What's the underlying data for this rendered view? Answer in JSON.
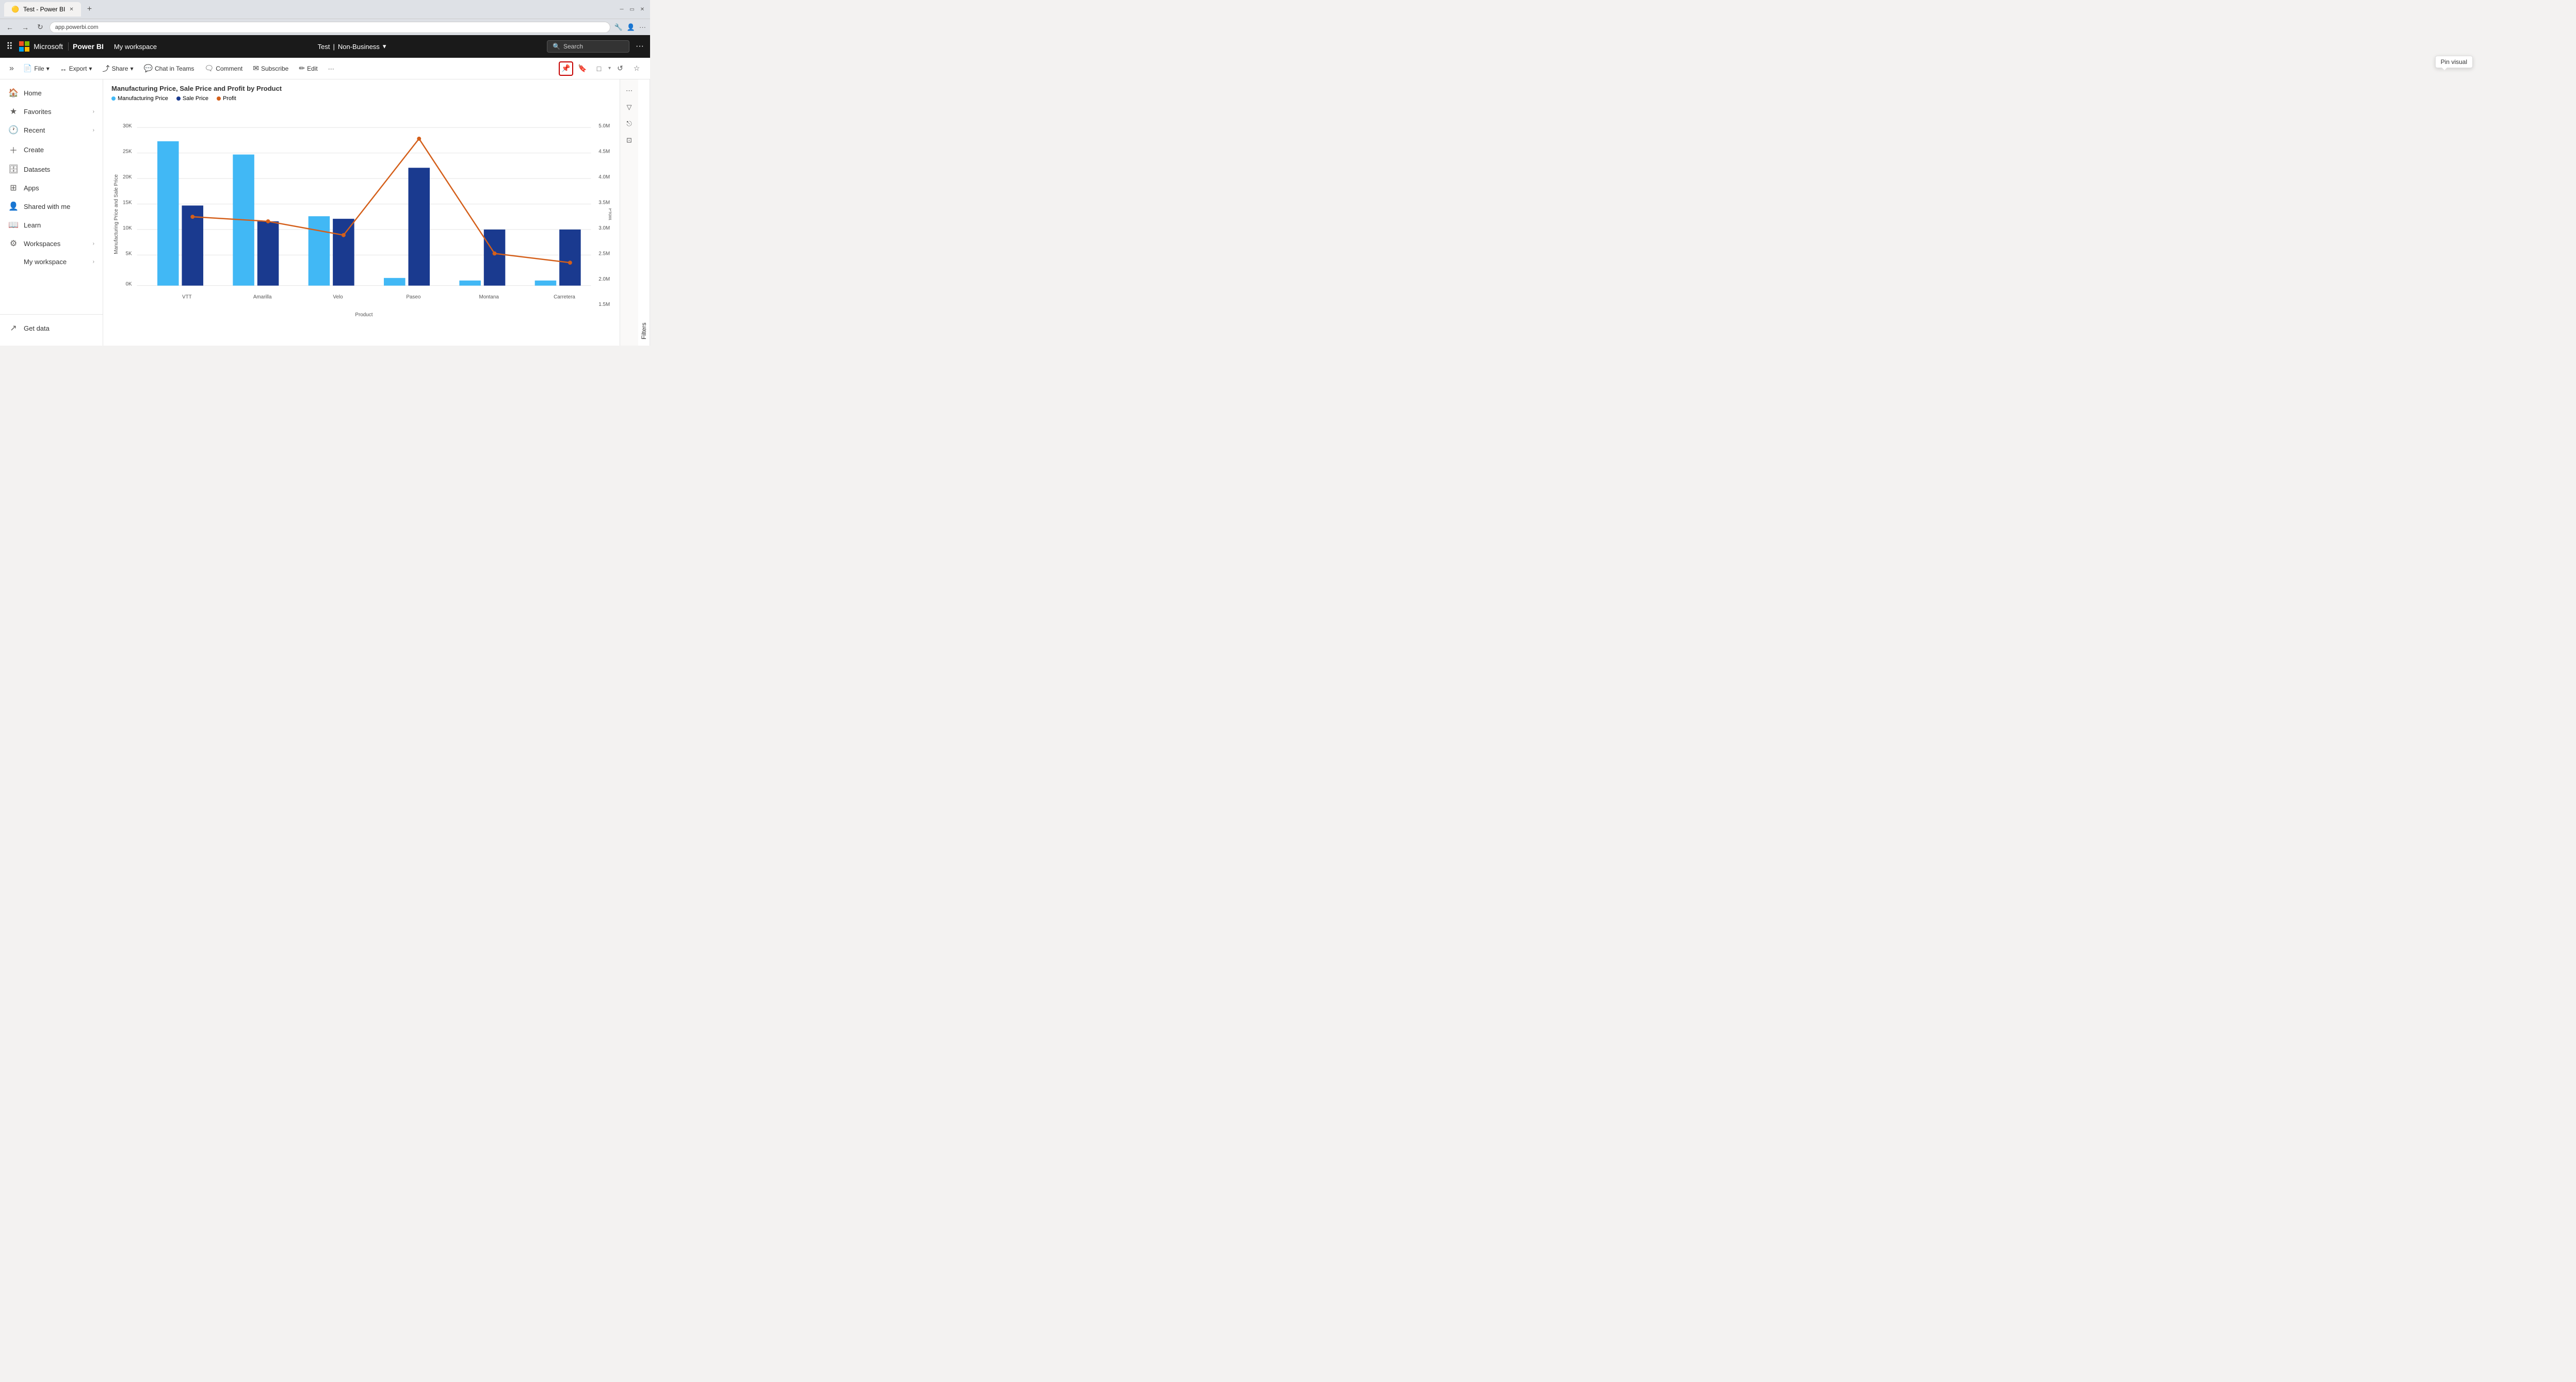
{
  "browser": {
    "tab_title": "Test - Power BI",
    "tab_favicon": "🟡",
    "new_tab_label": "+",
    "address": "app.powerbi.com",
    "nav": {
      "back": "←",
      "forward": "→",
      "refresh": "↻"
    }
  },
  "topnav": {
    "waffle": "⠿",
    "brand": "Microsoft",
    "product": "Power BI",
    "workspace": "My workspace",
    "report_title": "Test",
    "divider": "|",
    "classification": "Non-Business",
    "search_placeholder": "Search",
    "more": "···"
  },
  "toolbar": {
    "expand": "»",
    "file_label": "File",
    "export_label": "Export",
    "share_label": "Share",
    "chat_label": "Chat in Teams",
    "comment_label": "Comment",
    "subscribe_label": "Subscribe",
    "edit_label": "Edit",
    "more": "···"
  },
  "visual_toolbar": {
    "pin_tooltip": "Pin visual",
    "icons": [
      "📌",
      "🔖",
      "□",
      "↺",
      "☆",
      "⌂",
      "🔍",
      "▽",
      "⎋",
      "···"
    ]
  },
  "chart": {
    "title": "Manufacturing Price, Sale Price and Profit by Product",
    "legend": [
      {
        "label": "Manufacturing Price",
        "color": "#41b8f5"
      },
      {
        "label": "Sale Price",
        "color": "#1a3a8f"
      },
      {
        "label": "Profit",
        "color": "#d45f1a"
      }
    ],
    "y_left_label": "Manufacturing Price and Sale Price",
    "y_right_label": "Profit",
    "x_label": "Product",
    "y_left_ticks": [
      "0K",
      "5K",
      "10K",
      "15K",
      "20K",
      "25K",
      "30K"
    ],
    "y_right_ticks": [
      "1.5M",
      "2.0M",
      "2.5M",
      "3.0M",
      "3.5M",
      "4.0M",
      "4.5M",
      "5.0M"
    ],
    "products": [
      "VTT",
      "Amarilla",
      "Velo",
      "Paseo",
      "Montana",
      "Carretera"
    ],
    "manufacturing_prices": [
      27000,
      24500,
      13000,
      1500,
      1000,
      1000
    ],
    "sale_prices": [
      15000,
      12000,
      12500,
      22000,
      10500,
      10500
    ],
    "profits": [
      3000000,
      2900000,
      2600000,
      4700000,
      2200000,
      2000000
    ]
  },
  "sidebar": {
    "items": [
      {
        "label": "Home",
        "icon": "🏠"
      },
      {
        "label": "Favorites",
        "icon": "★",
        "arrow": "›"
      },
      {
        "label": "Recent",
        "icon": "🕐",
        "arrow": "›"
      },
      {
        "label": "Create",
        "icon": "+"
      },
      {
        "label": "Datasets",
        "icon": "🗄"
      },
      {
        "label": "Apps",
        "icon": "⊞"
      },
      {
        "label": "Shared with me",
        "icon": "👤"
      },
      {
        "label": "Learn",
        "icon": "📖"
      },
      {
        "label": "Workspaces",
        "icon": "⚙",
        "arrow": "›"
      },
      {
        "label": "My workspace",
        "icon": "",
        "arrow": "›"
      }
    ],
    "bottom": [
      {
        "label": "Get data",
        "icon": "↗"
      }
    ]
  },
  "filters_tab": "Filters"
}
